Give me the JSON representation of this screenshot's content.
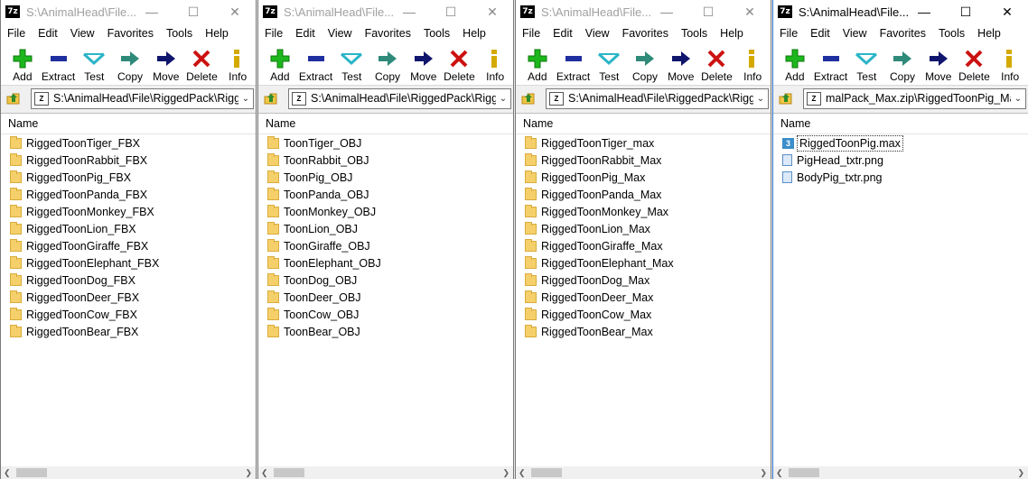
{
  "toolbar_labels": [
    "Add",
    "Extract",
    "Test",
    "Copy",
    "Move",
    "Delete",
    "Info"
  ],
  "menu_labels": [
    "File",
    "Edit",
    "View",
    "Favorites",
    "Tools",
    "Help"
  ],
  "column_name": "Name",
  "colors": {
    "add": "#1db71d",
    "extract": "#1f2f9f",
    "test": "#2ab5c7",
    "copy": "#2f8a7a",
    "move": "#10156e",
    "delete": "#cc1111",
    "info": "#d4a900"
  },
  "windows": [
    {
      "title": "S:\\AnimalHead\\File...",
      "path": "S:\\AnimalHead\\File\\RiggedPack\\Rigge",
      "items": [
        {
          "name": "RiggedToonTiger_FBX",
          "type": "folder"
        },
        {
          "name": "RiggedToonRabbit_FBX",
          "type": "folder"
        },
        {
          "name": "RiggedToonPig_FBX",
          "type": "folder"
        },
        {
          "name": "RiggedToonPanda_FBX",
          "type": "folder"
        },
        {
          "name": "RiggedToonMonkey_FBX",
          "type": "folder"
        },
        {
          "name": "RiggedToonLion_FBX",
          "type": "folder"
        },
        {
          "name": "RiggedToonGiraffe_FBX",
          "type": "folder"
        },
        {
          "name": "RiggedToonElephant_FBX",
          "type": "folder"
        },
        {
          "name": "RiggedToonDog_FBX",
          "type": "folder"
        },
        {
          "name": "RiggedToonDeer_FBX",
          "type": "folder"
        },
        {
          "name": "RiggedToonCow_FBX",
          "type": "folder"
        },
        {
          "name": "RiggedToonBear_FBX",
          "type": "folder"
        }
      ]
    },
    {
      "title": "S:\\AnimalHead\\File...",
      "path": "S:\\AnimalHead\\File\\RiggedPack\\Rigge",
      "items": [
        {
          "name": "ToonTiger_OBJ",
          "type": "folder"
        },
        {
          "name": "ToonRabbit_OBJ",
          "type": "folder"
        },
        {
          "name": "ToonPig_OBJ",
          "type": "folder"
        },
        {
          "name": "ToonPanda_OBJ",
          "type": "folder"
        },
        {
          "name": "ToonMonkey_OBJ",
          "type": "folder"
        },
        {
          "name": "ToonLion_OBJ",
          "type": "folder"
        },
        {
          "name": "ToonGiraffe_OBJ",
          "type": "folder"
        },
        {
          "name": "ToonElephant_OBJ",
          "type": "folder"
        },
        {
          "name": "ToonDog_OBJ",
          "type": "folder"
        },
        {
          "name": "ToonDeer_OBJ",
          "type": "folder"
        },
        {
          "name": "ToonCow_OBJ",
          "type": "folder"
        },
        {
          "name": "ToonBear_OBJ",
          "type": "folder"
        }
      ]
    },
    {
      "title": "S:\\AnimalHead\\File...",
      "path": "S:\\AnimalHead\\File\\RiggedPack\\Rigge",
      "items": [
        {
          "name": "RiggedToonTiger_max",
          "type": "folder"
        },
        {
          "name": "RiggedToonRabbit_Max",
          "type": "folder"
        },
        {
          "name": "RiggedToonPig_Max",
          "type": "folder"
        },
        {
          "name": "RiggedToonPanda_Max",
          "type": "folder"
        },
        {
          "name": "RiggedToonMonkey_Max",
          "type": "folder"
        },
        {
          "name": "RiggedToonLion_Max",
          "type": "folder"
        },
        {
          "name": "RiggedToonGiraffe_Max",
          "type": "folder"
        },
        {
          "name": "RiggedToonElephant_Max",
          "type": "folder"
        },
        {
          "name": "RiggedToonDog_Max",
          "type": "folder"
        },
        {
          "name": "RiggedToonDeer_Max",
          "type": "folder"
        },
        {
          "name": "RiggedToonCow_Max",
          "type": "folder"
        },
        {
          "name": "RiggedToonBear_Max",
          "type": "folder"
        }
      ]
    },
    {
      "title": "S:\\AnimalHead\\File...",
      "path": "malPack_Max.zip\\RiggedToonPig_Max\\",
      "items": [
        {
          "name": "RiggedToonPig.max",
          "type": "max",
          "selected": true
        },
        {
          "name": "PigHead_txtr.png",
          "type": "png"
        },
        {
          "name": "BodyPig_txtr.png",
          "type": "png"
        }
      ]
    }
  ]
}
